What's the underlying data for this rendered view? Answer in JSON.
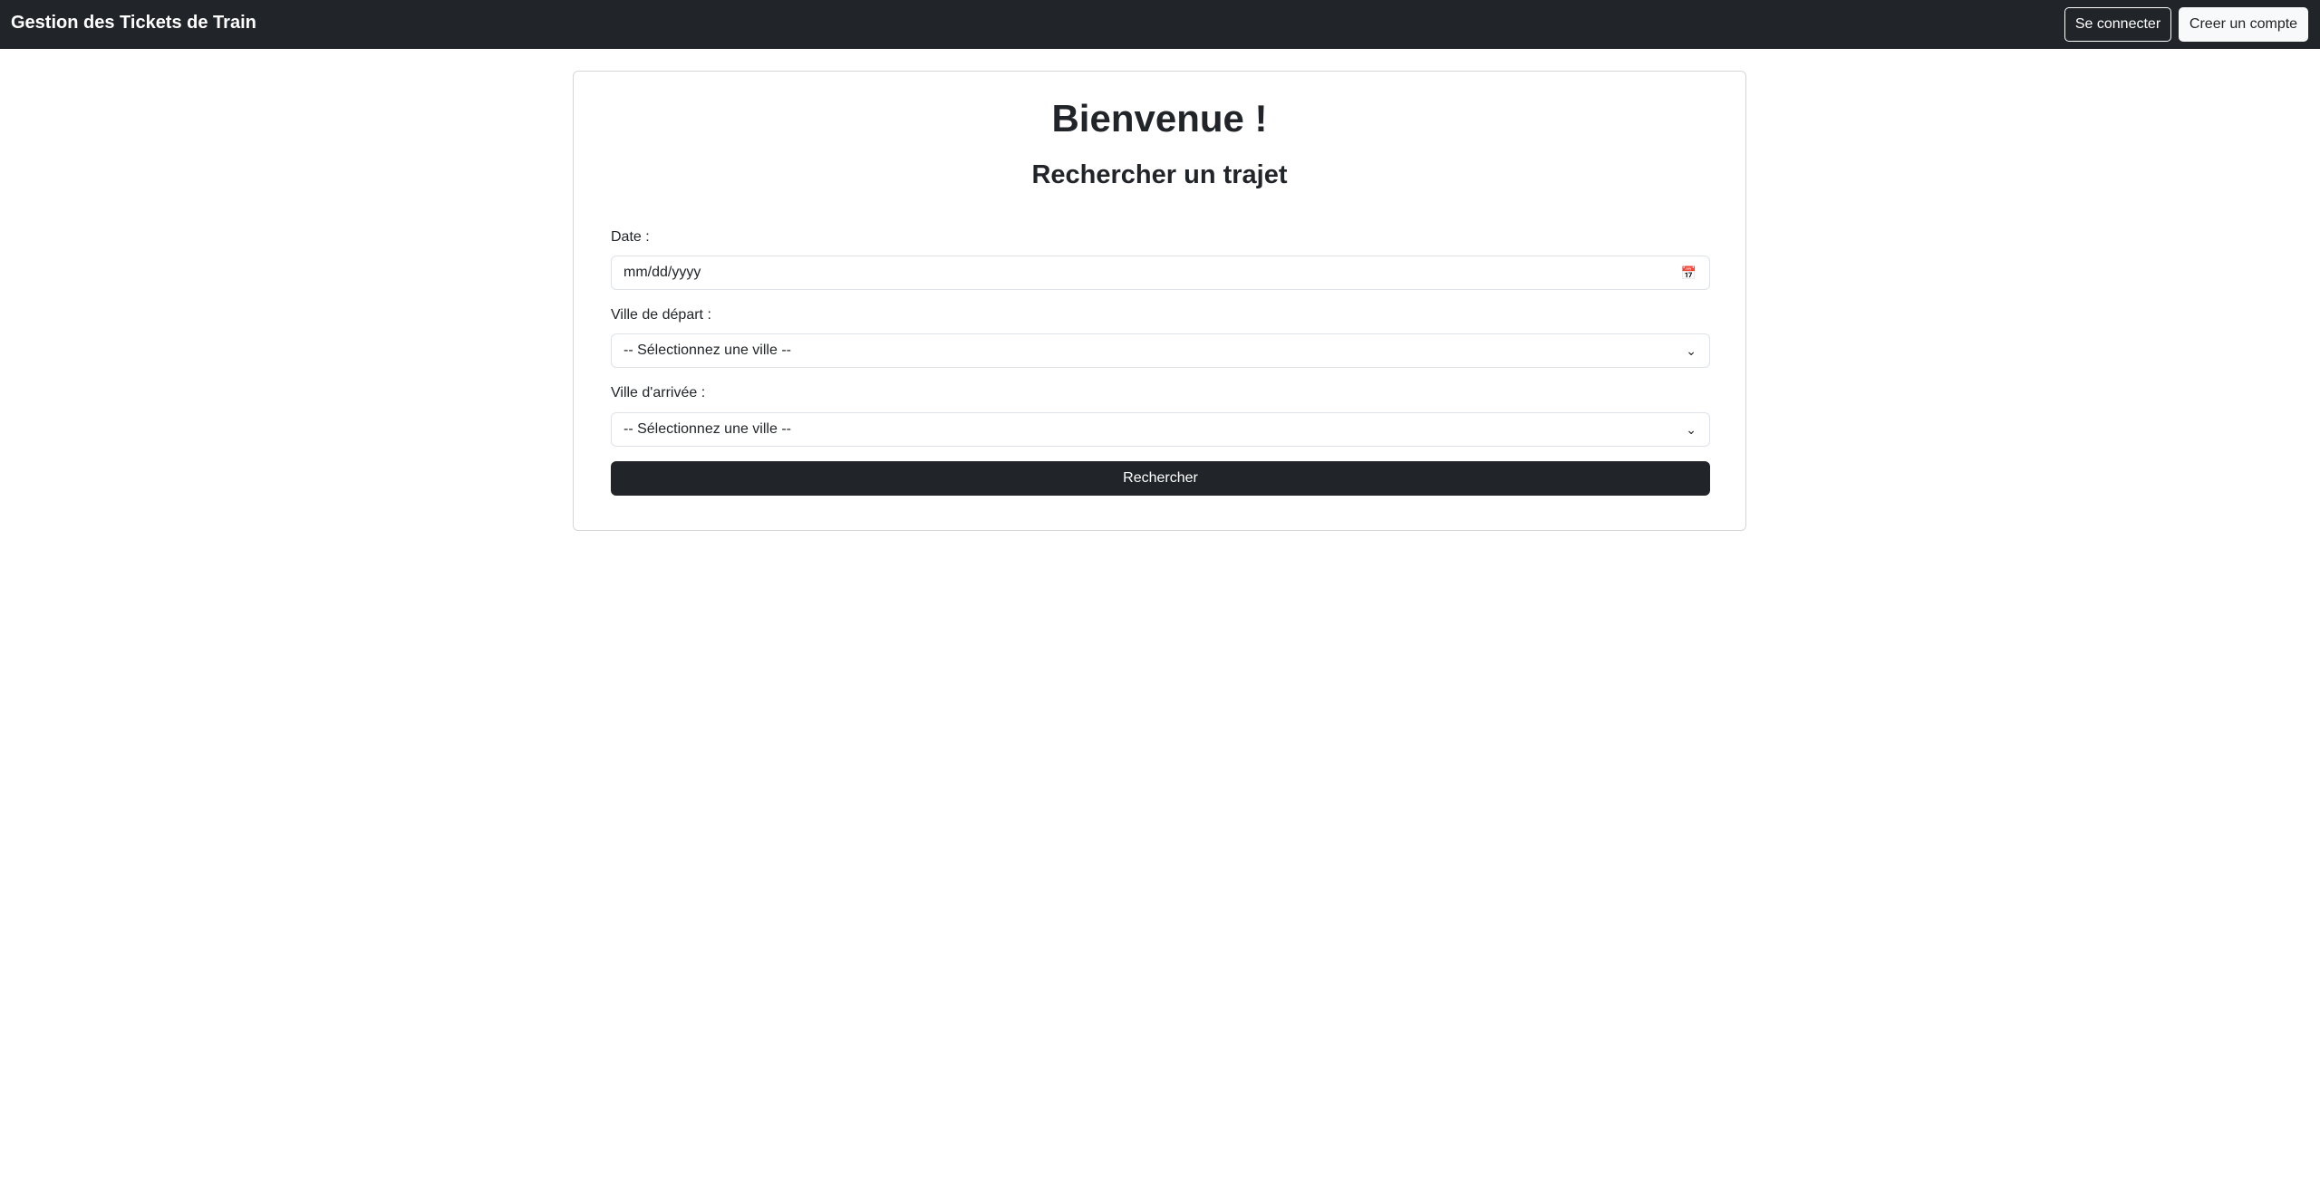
{
  "navbar": {
    "brand": "Gestion des Tickets de Train",
    "login_label": "Se connecter",
    "signup_label": "Creer un compte"
  },
  "main": {
    "title": "Bienvenue !",
    "subtitle": "Rechercher un trajet",
    "date_label": "Date :",
    "date_placeholder": "mm/dd/yyyy",
    "departure_label": "Ville de départ :",
    "departure_value": "-- Sélectionnez une ville --",
    "arrival_label": "Ville d'arrivée :",
    "arrival_value": "-- Sélectionnez une ville --",
    "search_label": "Rechercher"
  }
}
